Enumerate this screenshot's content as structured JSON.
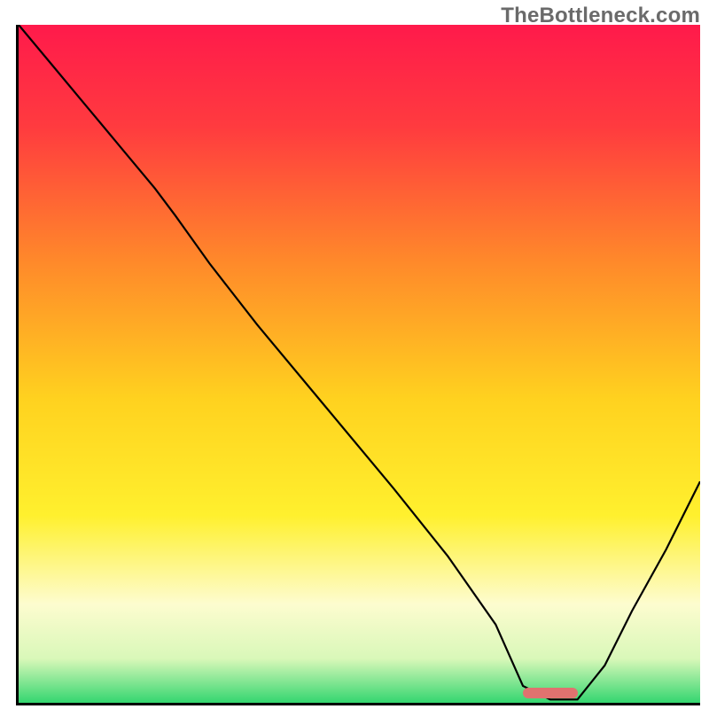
{
  "watermark": "TheBottleneck.com",
  "colors": {
    "axis": "#000000",
    "curve": "#000000",
    "watermark_text": "#6a6a6a",
    "marker": "#e0726f",
    "gradient_stops": [
      {
        "offset": 0.0,
        "color": "#ff1a4b"
      },
      {
        "offset": 0.15,
        "color": "#ff3b3f"
      },
      {
        "offset": 0.35,
        "color": "#ff8a2a"
      },
      {
        "offset": 0.55,
        "color": "#ffd21f"
      },
      {
        "offset": 0.72,
        "color": "#fff02e"
      },
      {
        "offset": 0.85,
        "color": "#fdfccf"
      },
      {
        "offset": 0.93,
        "color": "#d9f8b9"
      },
      {
        "offset": 1.0,
        "color": "#27d36a"
      }
    ]
  },
  "chart_data": {
    "type": "line",
    "title": "",
    "xlabel": "",
    "ylabel": "",
    "xlim": [
      0,
      100
    ],
    "ylim": [
      0,
      100
    ],
    "grid": false,
    "legend": false,
    "marker": {
      "x_start": 74,
      "x_end": 82,
      "y": 1.5
    },
    "series": [
      {
        "name": "bottleneck-curve",
        "x": [
          0,
          5,
          10,
          15,
          20,
          23,
          28,
          35,
          45,
          55,
          63,
          70,
          74,
          78,
          82,
          86,
          90,
          95,
          100
        ],
        "y": [
          100,
          94,
          88,
          82,
          76,
          72,
          65,
          56,
          44,
          32,
          22,
          12,
          3,
          1,
          1,
          6,
          14,
          23,
          33
        ]
      }
    ],
    "notes": "V-shaped curve over vertical red→green gradient; minimum ≈ x 74–82. Values estimated from pixels; image has no numeric tick labels."
  }
}
